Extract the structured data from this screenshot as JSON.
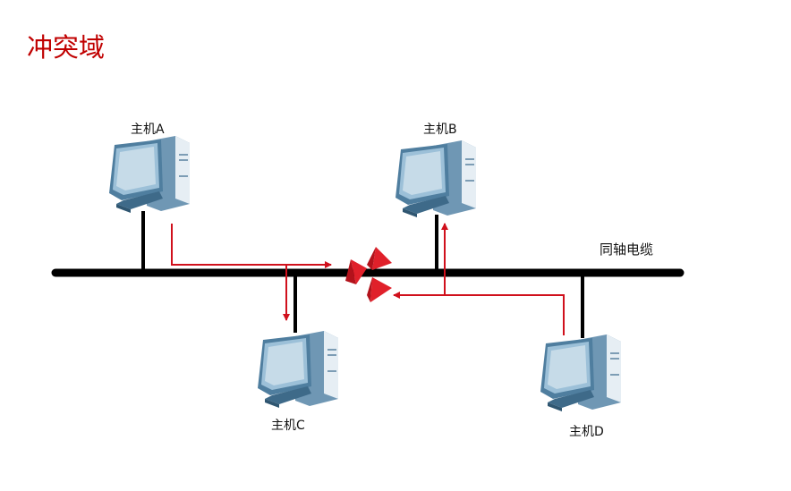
{
  "title": "冲突域",
  "cable_label": "同轴电缆",
  "hosts": [
    {
      "label": "主机A"
    },
    {
      "label": "主机B"
    },
    {
      "label": "主机C"
    },
    {
      "label": "主机D"
    }
  ],
  "colors": {
    "title": "#c00000",
    "signal": "#d0101c",
    "bus": "#000000",
    "computer": "#5f8fae"
  }
}
